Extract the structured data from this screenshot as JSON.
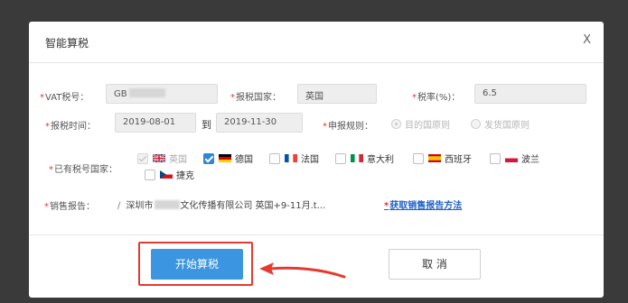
{
  "dialog": {
    "title": "智能算税",
    "close_glyph": "X"
  },
  "form": {
    "vat_label": "VAT税号：",
    "vat_value_prefix": "GB",
    "country_label": "报税国家：",
    "country_value": "英国",
    "rate_label": "税率(%)：",
    "rate_value": "6.5",
    "time_label": "报税时间：",
    "start_date": "2019-08-01",
    "to_text": "到",
    "end_date": "2019-11-30",
    "rule_label": "申报规则：",
    "rule_option_1": "目的国原则",
    "rule_option_2": "发货国原则",
    "existing_label": "已有税号国家：",
    "countries": [
      {
        "label": "英国",
        "checked": true,
        "disabled": true,
        "flag_colors": [
          "#1c2f7a",
          "#cc1a2b",
          "#ffffff"
        ]
      },
      {
        "label": "德国",
        "checked": true,
        "disabled": false,
        "flag_colors": [
          "#000000",
          "#dd0000",
          "#ffce00"
        ]
      },
      {
        "label": "法国",
        "checked": false,
        "disabled": false,
        "flag_colors": [
          "#0055a4",
          "#ffffff",
          "#ef4135"
        ]
      },
      {
        "label": "意大利",
        "checked": false,
        "disabled": false,
        "flag_colors": [
          "#009246",
          "#ffffff",
          "#ce2b37"
        ]
      },
      {
        "label": "西班牙",
        "checked": false,
        "disabled": false,
        "flag_colors": [
          "#c60b1e",
          "#ffc400",
          "#c60b1e"
        ]
      },
      {
        "label": "波兰",
        "checked": false,
        "disabled": false,
        "flag_colors": [
          "#ffffff",
          "#dc143c"
        ]
      },
      {
        "label": "捷克",
        "checked": false,
        "disabled": false,
        "flag_colors": [
          "#ffffff",
          "#d7141a",
          "#11457e"
        ]
      }
    ],
    "sales_label": "销售报告：",
    "file_name_prefix": "深圳市",
    "file_name_suffix": "文化传播有限公司 英国+9-11月.t...",
    "report_link": "获取销售报告方法"
  },
  "footer": {
    "start_button": "开始算税",
    "cancel_button": "取 消"
  },
  "colors": {
    "primary": "#3b95e0",
    "highlight": "#e53a30",
    "link": "#1e60c9",
    "required": "#e03a2f"
  }
}
